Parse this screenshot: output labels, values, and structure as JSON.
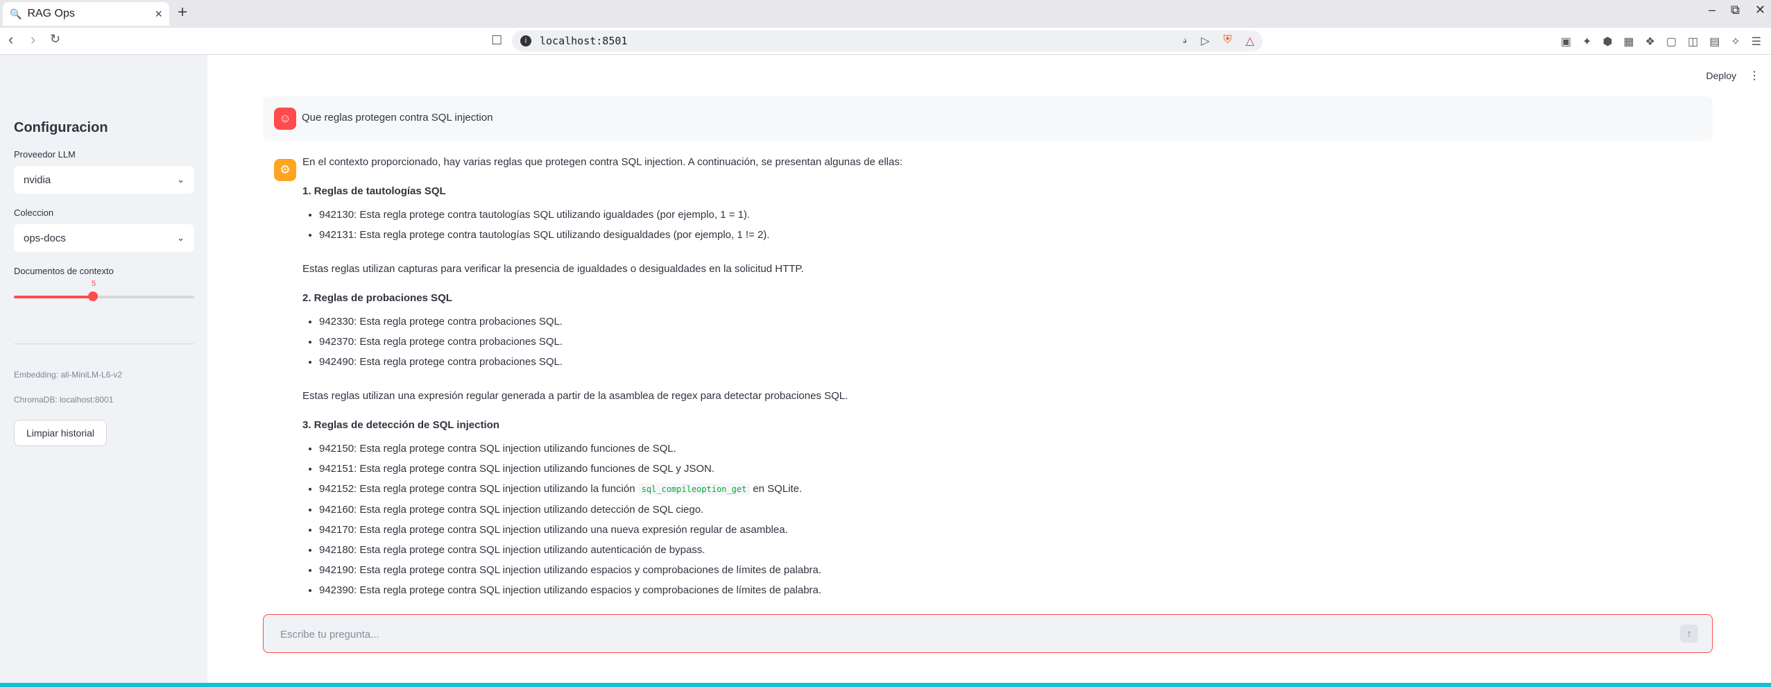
{
  "browser": {
    "tab_title": "RAG Ops",
    "tab_icon": "search-icon",
    "url": "localhost:8501",
    "new_tab": "+",
    "close_tab": "×"
  },
  "app": {
    "deploy_label": "Deploy"
  },
  "sidebar": {
    "title": "Configuracion",
    "llm_label": "Proveedor LLM",
    "llm_value": "nvidia",
    "collection_label": "Coleccion",
    "collection_value": "ops-docs",
    "context_label": "Documentos de contexto",
    "context_value": 5,
    "context_fraction": 0.44,
    "embedding": "Embedding: all-MiniLM-L6-v2",
    "chromadb": "ChromaDB: localhost:8001",
    "clear_button": "Limpiar historial"
  },
  "chat": {
    "user_message": "Que reglas protegen contra SQL injection",
    "bot": {
      "intro": "En el contexto proporcionado, hay varias reglas que protegen contra SQL injection. A continuación, se presentan algunas de ellas:",
      "section1_title": "1. Reglas de tautologías SQL",
      "section1_items": [
        "942130: Esta regla protege contra tautologías SQL utilizando igualdades (por ejemplo, 1 = 1).",
        "942131: Esta regla protege contra tautologías SQL utilizando desigualdades (por ejemplo, 1 != 2)."
      ],
      "section1_note": "Estas reglas utilizan capturas para verificar la presencia de igualdades o desigualdades en la solicitud HTTP.",
      "section2_title": "2. Reglas de probaciones SQL",
      "section2_items": [
        "942330: Esta regla protege contra probaciones SQL.",
        "942370: Esta regla protege contra probaciones SQL.",
        "942490: Esta regla protege contra probaciones SQL."
      ],
      "section2_note": "Estas reglas utilizan una expresión regular generada a partir de la asamblea de regex para detectar probaciones SQL.",
      "section3_title": "3. Reglas de detección de SQL injection",
      "section3_items_a": [
        "942150: Esta regla protege contra SQL injection utilizando funciones de SQL.",
        "942151: Esta regla protege contra SQL injection utilizando funciones de SQL y JSON."
      ],
      "item_942152_prefix": "942152: Esta regla protege contra SQL injection utilizando la función",
      "item_942152_code": "sql_compileoption_get",
      "item_942152_suffix": "en SQLite.",
      "section3_items_b": [
        "942160: Esta regla protege contra SQL injection utilizando detección de SQL ciego.",
        "942170: Esta regla protege contra SQL injection utilizando una nueva expresión regular de asamblea.",
        "942180: Esta regla protege contra SQL injection utilizando autenticación de bypass.",
        "942190: Esta regla protege contra SQL injection utilizando espacios y comprobaciones de límites de palabra.",
        "942390: Esta regla protege contra SQL injection utilizando espacios y comprobaciones de límites de palabra."
      ]
    },
    "input_placeholder": "Escribe tu pregunta..."
  },
  "colors": {
    "accent": "#ff4b4b",
    "bot_avatar": "#ffa421",
    "sidebar_bg": "#f0f2f6",
    "code_green": "#09ab3b",
    "status_bar": "#14c0d7"
  }
}
